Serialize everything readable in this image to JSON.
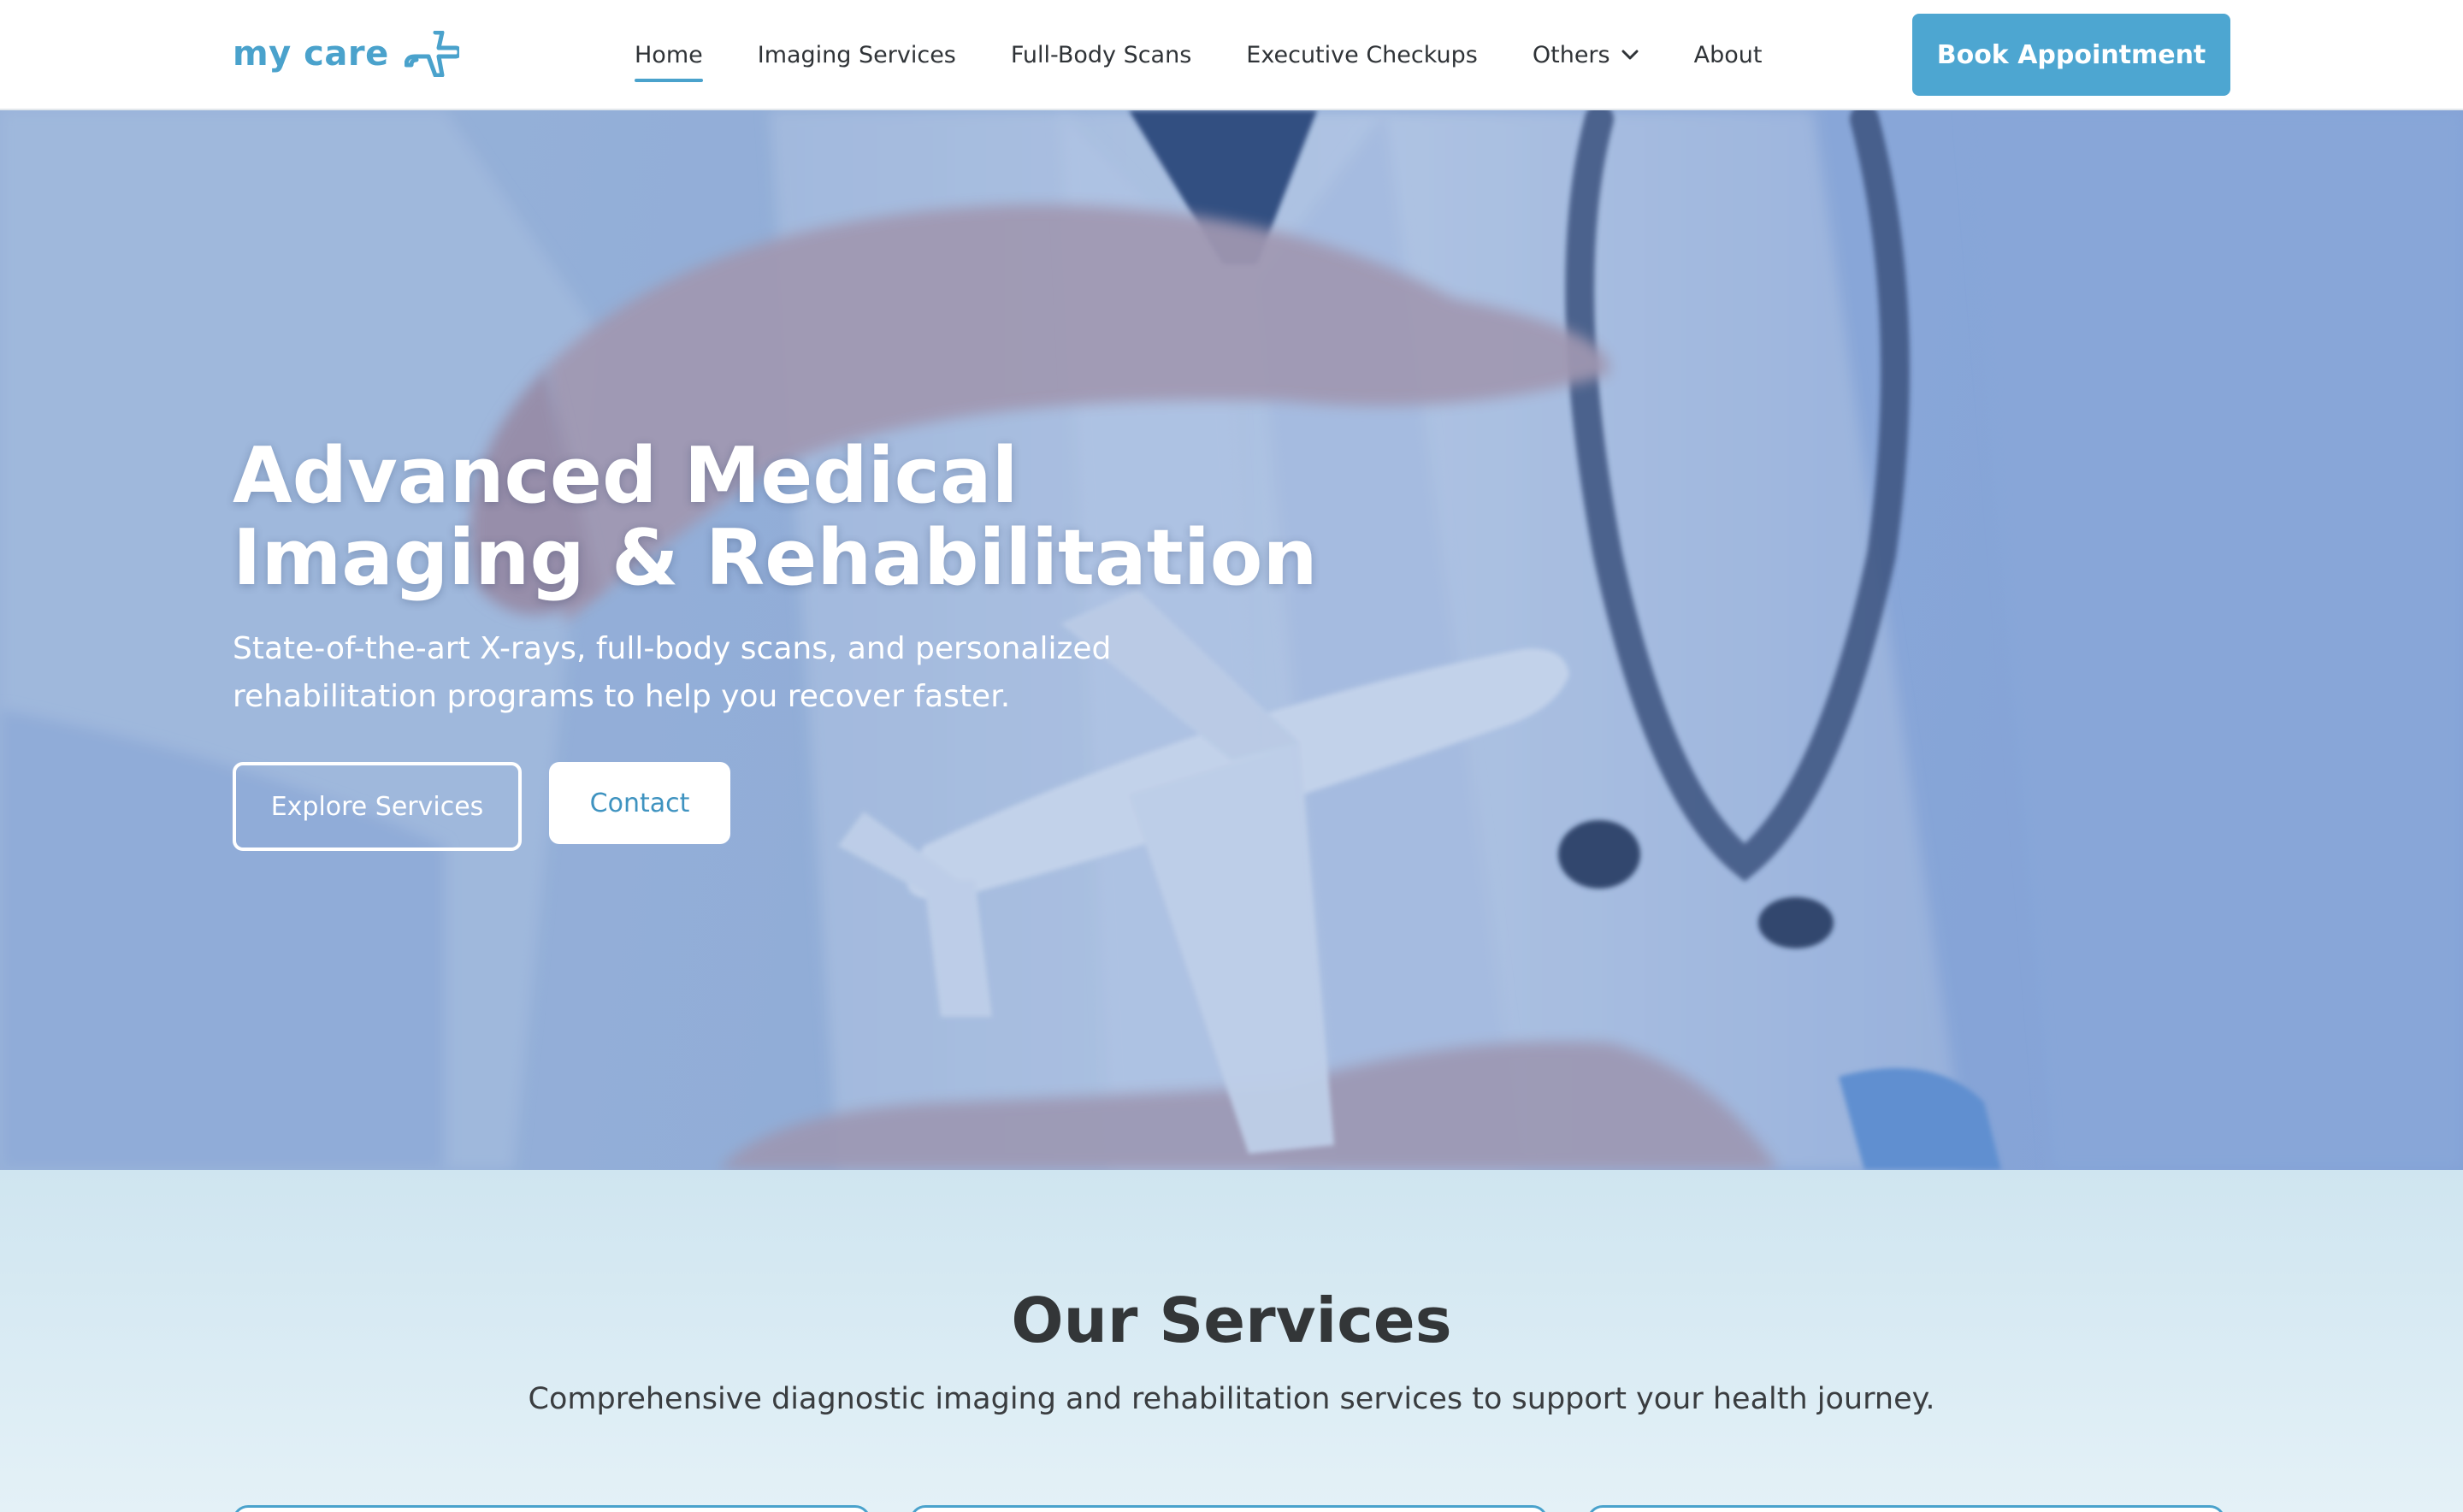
{
  "brand": {
    "name": "my care",
    "accent": "#4aa2cc",
    "logo_icon": "airplane-icon"
  },
  "nav": {
    "links": [
      {
        "label": "Home",
        "active": true
      },
      {
        "label": "Imaging Services"
      },
      {
        "label": "Full-Body Scans"
      },
      {
        "label": "Executive Checkups"
      },
      {
        "label": "Others",
        "has_dropdown": true,
        "dropdown_icon": "chevron-down-icon"
      },
      {
        "label": "About"
      }
    ],
    "cta": "Book Appointment",
    "cta_color": "#4da6d1"
  },
  "hero": {
    "title_line1": "Advanced Medical",
    "title_line2": "Imaging & Rehabilitation",
    "subtitle": "State-of-the-art X-rays, full-body scans, and personalized rehabilitation programs to help you recover faster.",
    "primary_button": "Explore Services",
    "secondary_button": "Contact",
    "background_image": "doctor hands around a model airplane"
  },
  "services": {
    "title": "Our Services",
    "subtitle": "Comprehensive diagnostic imaging and rehabilitation services to support your health journey.",
    "card_count": 3
  }
}
